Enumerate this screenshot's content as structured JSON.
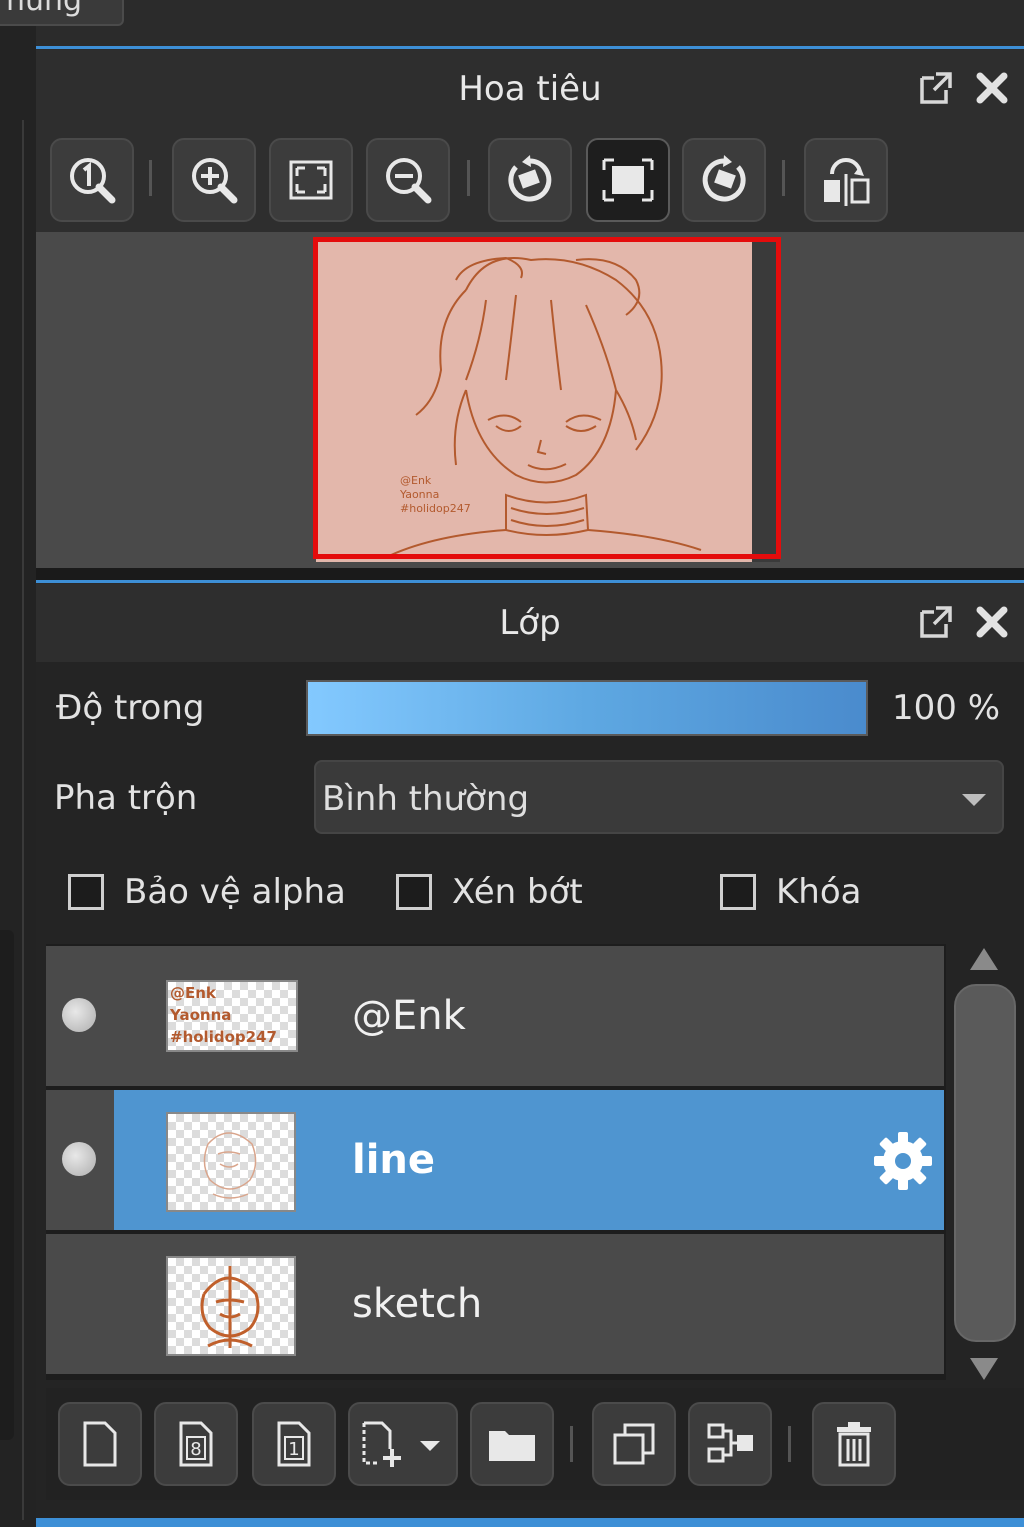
{
  "top_tab": {
    "label": "nung"
  },
  "navigator": {
    "title": "Hoa tiêu",
    "toolbar": [
      {
        "name": "zoom-actual-button",
        "icon": "zoom-1-icon"
      },
      {
        "name": "zoom-in-button",
        "icon": "zoom-in-icon"
      },
      {
        "name": "fit-screen-button",
        "icon": "fit-screen-icon"
      },
      {
        "name": "zoom-out-button",
        "icon": "zoom-out-icon"
      },
      {
        "name": "rotate-left-button",
        "icon": "rotate-left-icon"
      },
      {
        "name": "reset-rotation-button",
        "icon": "reset-view-icon"
      },
      {
        "name": "rotate-right-button",
        "icon": "rotate-right-icon"
      },
      {
        "name": "flip-horizontal-button",
        "icon": "flip-horizontal-icon"
      }
    ],
    "preview_text": [
      "@Enk",
      "Yaonna",
      "#holidop247"
    ]
  },
  "layers_panel": {
    "title": "Lớp",
    "opacity_label": "Độ trong",
    "opacity_value": "100 %",
    "opacity_fraction": 1.0,
    "blend_label": "Pha trộn",
    "blend_value": "Bình thường",
    "checkboxes": {
      "protect_alpha": "Bảo vệ alpha",
      "clipping": "Xén bớt",
      "lock": "Khóa"
    },
    "layers": [
      {
        "name": "@Enk",
        "visible": true,
        "selected": false
      },
      {
        "name": "line",
        "visible": true,
        "selected": true
      },
      {
        "name": "sketch",
        "visible": false,
        "selected": false
      }
    ],
    "bottom_toolbar": [
      "new-layer-icon",
      "new-8bit-layer-icon",
      "new-1bit-layer-icon",
      "add-layer-menu-icon",
      "new-folder-icon",
      "duplicate-layer-icon",
      "merge-layer-icon",
      "delete-layer-icon"
    ]
  },
  "colors": {
    "accent": "#3d8fd6",
    "selection": "#4f95d0",
    "viewport_frame": "#e40c0c",
    "canvas_tint": "#e3b7ab",
    "line_art": "#b35a2e"
  }
}
